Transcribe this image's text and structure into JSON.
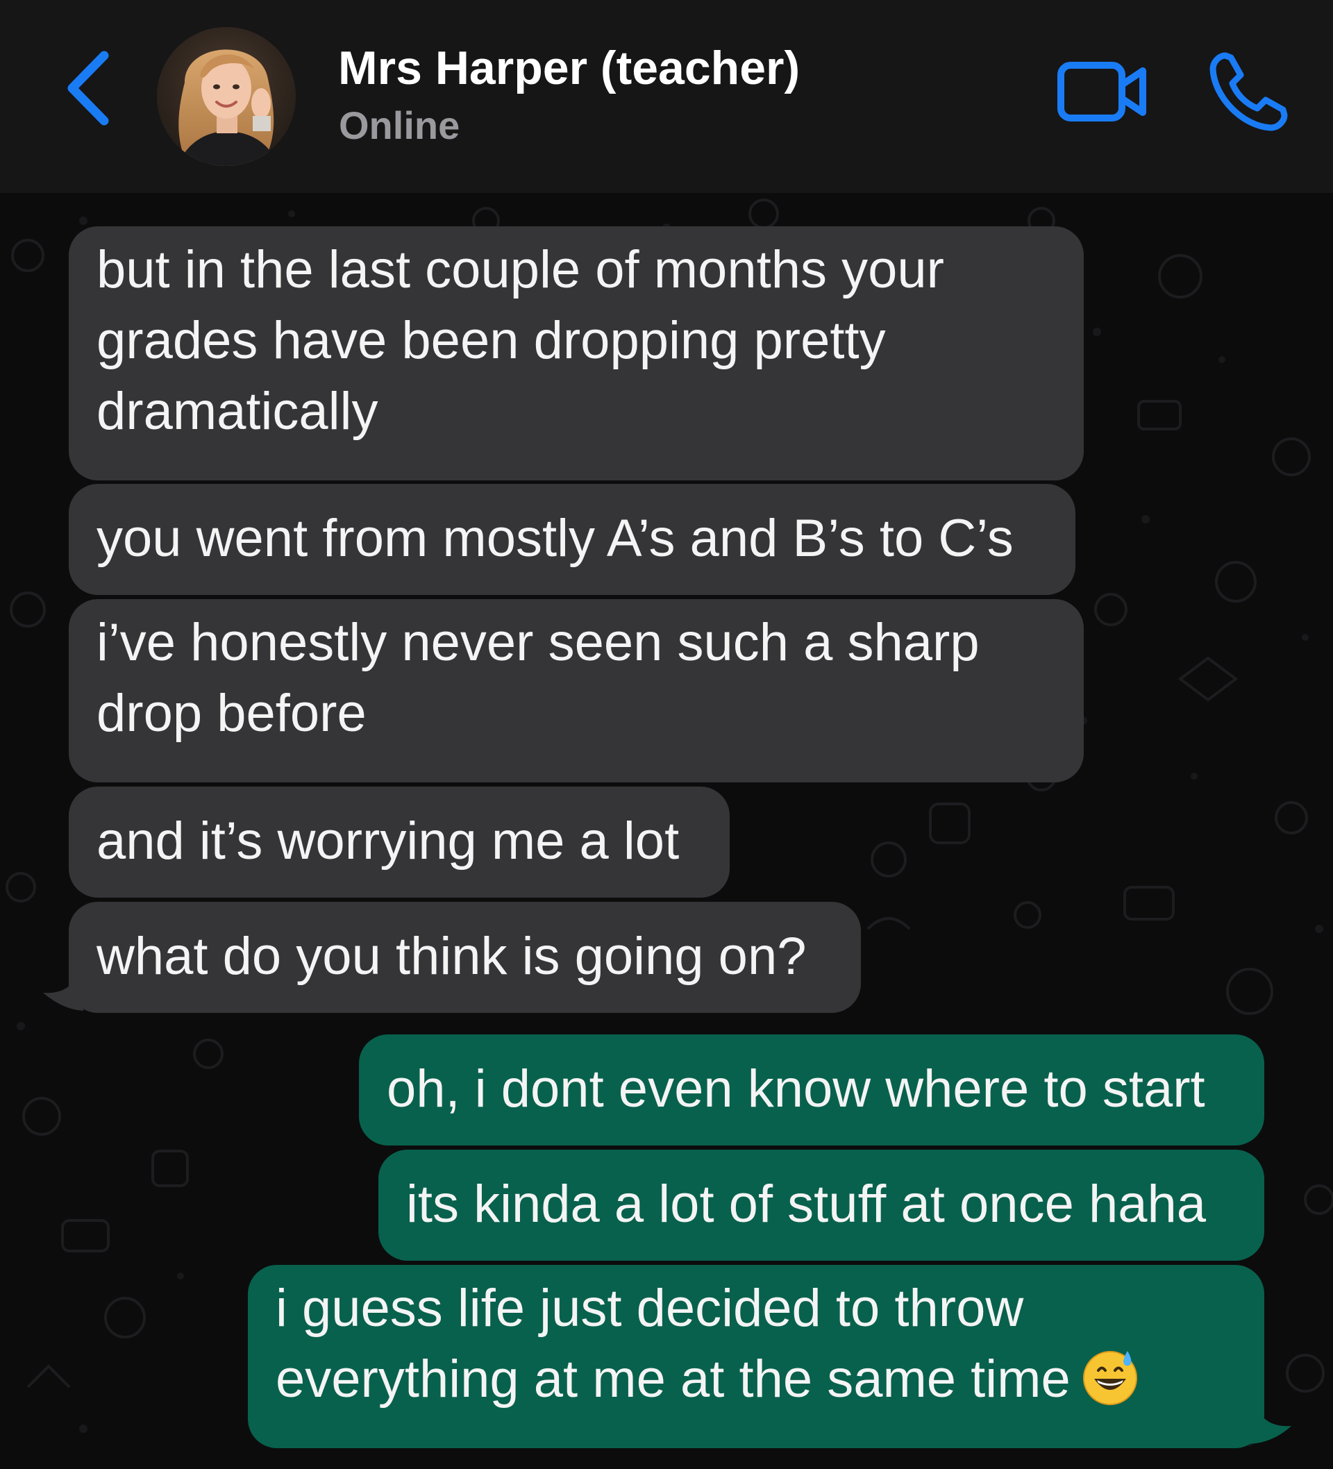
{
  "header": {
    "contact_name": "Mrs Harper (teacher)",
    "status": "Online",
    "back_icon": "chevron-left-icon",
    "video_icon": "video-camera-icon",
    "call_icon": "phone-icon",
    "accent_color": "#1a7cf5"
  },
  "messages": [
    {
      "direction": "incoming",
      "lines": [
        "but in the last couple of months your",
        "grades have been dropping pretty",
        "dramatically"
      ]
    },
    {
      "direction": "incoming",
      "lines": [
        "you went from mostly A’s and B’s to C’s"
      ]
    },
    {
      "direction": "incoming",
      "lines": [
        "i’ve honestly never seen such a sharp",
        "drop before"
      ]
    },
    {
      "direction": "incoming",
      "lines": [
        "and it’s worrying me a lot"
      ]
    },
    {
      "direction": "incoming",
      "lines": [
        "what do you think is going on?"
      ]
    },
    {
      "direction": "outgoing",
      "lines": [
        "oh, i dont even know where to start"
      ]
    },
    {
      "direction": "outgoing",
      "lines": [
        "its kinda a lot of stuff at once haha"
      ]
    },
    {
      "direction": "outgoing",
      "lines": [
        "i guess life just decided to throw",
        "everything at me at the same time"
      ],
      "emoji": "grinning-face-with-sweat-emoji"
    }
  ],
  "colors": {
    "header_bg": "#161617",
    "chat_bg": "#0c0c0d",
    "incoming_bubble": "#353538",
    "outgoing_bubble": "#08614d",
    "text": "#f4f4f4",
    "status_text": "#9a9a9e"
  }
}
